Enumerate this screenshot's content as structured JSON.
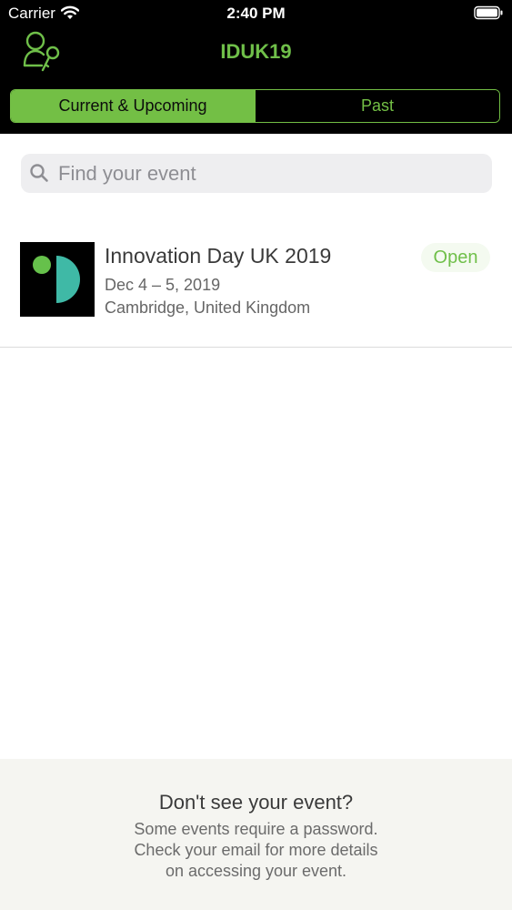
{
  "status_bar": {
    "carrier": "Carrier",
    "time": "2:40 PM"
  },
  "nav": {
    "title": "IDUK19",
    "logo_icon": "user-key-icon"
  },
  "segments": [
    {
      "label": "Current & Upcoming",
      "active": true
    },
    {
      "label": "Past",
      "active": false
    }
  ],
  "search": {
    "placeholder": "Find your event",
    "value": ""
  },
  "events": [
    {
      "name": "Innovation Day UK 2019",
      "dates": "Dec 4 – 5, 2019",
      "location": "Cambridge, United Kingdom",
      "status": "Open"
    }
  ],
  "footer": {
    "title": "Don't see your event?",
    "lines": [
      "Some events require a password.",
      "Check your email for more details",
      "on accessing your event."
    ]
  },
  "colors": {
    "accent": "#73bf45",
    "header_bg": "#000000",
    "logo_teal": "#3fb9a6"
  }
}
